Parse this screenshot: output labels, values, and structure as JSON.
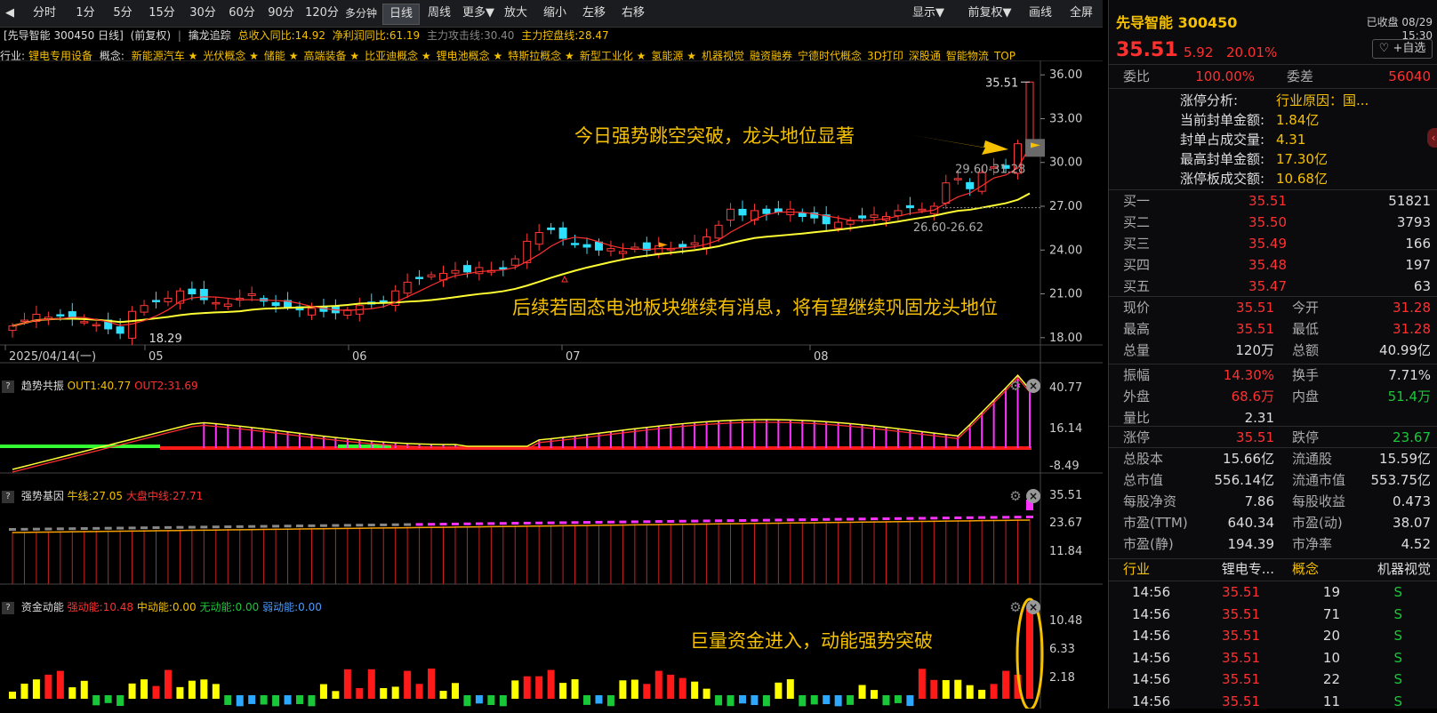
{
  "toolbar": {
    "buttons": [
      "分时",
      "1分",
      "5分",
      "15分",
      "30分",
      "60分",
      "90分",
      "120分",
      "多分钟",
      "日线",
      "周线",
      "更多▼",
      "放大",
      "缩小",
      "左移",
      "右移"
    ],
    "right_buttons": [
      "显示▼",
      "前复权▼",
      "画线",
      "全屏"
    ]
  },
  "info1": {
    "title": "[先导智能 300450 日线]",
    "adjust": "(前复权)",
    "indicator": "擒龙追踪",
    "revenue": "总收入同比:14.92",
    "profit": "净利润同比:61.19",
    "attack": "主力攻击线:30.40",
    "control": "主力控盘线:28.47"
  },
  "info2": {
    "industry_label": "行业:",
    "industry": "锂电专用设备",
    "concept_label": "概念:",
    "concepts": [
      "新能源汽车 ★",
      "光伏概念 ★",
      "储能 ★",
      "高端装备 ★",
      "比亚迪概念 ★",
      "锂电池概念 ★",
      "特斯拉概念 ★",
      "新型工业化 ★",
      "氢能源 ★",
      "机器视觉",
      "融资融券",
      "宁德时代概念",
      "3D打印",
      "深股通",
      "智能物流",
      "TOP"
    ]
  },
  "main_chart": {
    "y_ticks": [
      "36.00",
      "33.00",
      "30.00",
      "27.00",
      "24.00",
      "21.00",
      "18.00"
    ],
    "x_labels": [
      "2025/04/14(一)",
      "05",
      "06",
      "07",
      "08"
    ],
    "high_label": "35.51",
    "low_label": "18.29",
    "range_label1": "29.60-31.28",
    "range_label2": "26.60-26.62",
    "annotation1": "今日强势跳空突破，龙头地位显著",
    "annotation2": "后续若固态电池板块继续有消息，将有望继续巩固龙头地位"
  },
  "panel1": {
    "name": "趋势共振",
    "out1": "OUT1:40.77",
    "out2": "OUT2:31.69",
    "y_ticks": [
      "40.77",
      "16.14",
      "-8.49"
    ]
  },
  "panel2": {
    "name": "强势基因",
    "niu": "牛线:27.05",
    "dapan": "大盘中线:27.71",
    "y_ticks": [
      "35.51",
      "23.67",
      "11.84"
    ]
  },
  "panel3": {
    "name": "资金动能",
    "strong": "强动能:10.48",
    "mid": "中动能:0.00",
    "none": "无动能:0.00",
    "weak": "弱动能:0.00",
    "y_ticks": [
      "10.48",
      "6.33",
      "2.18"
    ],
    "annotation": "巨量资金进入，动能强势突破"
  },
  "chart_data": {
    "type": "candlestick",
    "title": "先导智能 300450 日线",
    "x_range": [
      "2025/04/14",
      "2025/08/29"
    ],
    "ylim": [
      17.5,
      36.5
    ],
    "close": [
      18.8,
      19.2,
      19.6,
      19.4,
      19.5,
      19.3,
      19.1,
      18.9,
      18.6,
      18.3,
      19.8,
      20.2,
      20.5,
      20.7,
      21.2,
      21.0,
      20.6,
      20.4,
      20.3,
      20.7,
      21.0,
      20.5,
      20.2,
      20.1,
      19.9,
      20.0,
      19.8,
      19.7,
      19.9,
      20.2,
      20.3,
      20.5,
      21.2,
      21.8,
      22.1,
      22.3,
      22.4,
      22.6,
      22.5,
      22.8,
      22.6,
      22.7,
      23.4,
      24.6,
      25.2,
      25.4,
      24.8,
      24.4,
      24.2,
      24.0,
      24.1,
      23.9,
      24.2,
      24.0,
      24.3,
      24.1,
      24.2,
      24.5,
      24.9,
      25.7,
      26.8,
      26.4,
      26.7,
      26.5,
      26.6,
      26.8,
      26.3,
      26.2,
      25.8,
      25.9,
      26.0,
      26.2,
      26.4,
      26.3,
      26.7,
      26.9,
      26.8,
      27.0,
      28.6,
      28.9,
      28.2,
      29.3,
      29.7,
      29.6,
      31.28,
      35.51
    ],
    "ma_yellow_end": 28.47,
    "ma_red_end": 30.4
  },
  "right": {
    "name": "先导智能",
    "code": "300450",
    "status": "已收盘 08/29 15:30",
    "price": "35.51",
    "change": "5.92",
    "pct": "20.01%",
    "self_select": "+自选",
    "weibi_label": "委比",
    "weibi": "100.00%",
    "weicha_label": "委差",
    "weicha": "56040",
    "zt": [
      {
        "k": "涨停分析:",
        "v": "行业原因：国..."
      },
      {
        "k": "当前封单金额:",
        "v": "1.84亿"
      },
      {
        "k": "封单占成交量:",
        "v": "4.31"
      },
      {
        "k": "最高封单金额:",
        "v": "17.30亿"
      },
      {
        "k": "涨停板成交额:",
        "v": "10.68亿"
      }
    ],
    "buys": [
      {
        "k": "买一",
        "p": "35.51",
        "v": "51821"
      },
      {
        "k": "买二",
        "p": "35.50",
        "v": "3793"
      },
      {
        "k": "买三",
        "p": "35.49",
        "v": "166"
      },
      {
        "k": "买四",
        "p": "35.48",
        "v": "197"
      },
      {
        "k": "买五",
        "p": "35.47",
        "v": "63"
      }
    ],
    "stats1": [
      {
        "k1": "现价",
        "v1": "35.51",
        "c1": "red",
        "k2": "今开",
        "v2": "31.28",
        "c2": "red"
      },
      {
        "k1": "最高",
        "v1": "35.51",
        "c1": "red",
        "k2": "最低",
        "v2": "31.28",
        "c2": "red"
      },
      {
        "k1": "总量",
        "v1": "120万",
        "c1": "white",
        "k2": "总额",
        "v2": "40.99亿",
        "c2": "white"
      }
    ],
    "stats2": [
      {
        "k1": "振幅",
        "v1": "14.30%",
        "c1": "red",
        "k2": "换手",
        "v2": "7.71%",
        "c2": "white"
      },
      {
        "k1": "外盘",
        "v1": "68.6万",
        "c1": "red",
        "k2": "内盘",
        "v2": "51.4万",
        "c2": "green"
      },
      {
        "k1": "量比",
        "v1": "2.31",
        "c1": "white",
        "k2": "",
        "v2": "",
        "c2": "white"
      }
    ],
    "stats3": [
      {
        "k1": "涨停",
        "v1": "35.51",
        "c1": "red",
        "k2": "跌停",
        "v2": "23.67",
        "c2": "green"
      }
    ],
    "stats4": [
      {
        "k1": "总股本",
        "v1": "15.66亿",
        "k2": "流通股",
        "v2": "15.59亿"
      },
      {
        "k1": "总市值",
        "v1": "556.14亿",
        "k2": "流通市值",
        "v2": "553.75亿"
      },
      {
        "k1": "每股净资",
        "v1": "7.86",
        "k2": "每股收益",
        "v2": "0.473"
      },
      {
        "k1": "市盈(TTM)",
        "v1": "640.34",
        "k2": "市盈(动)",
        "v2": "38.07"
      },
      {
        "k1": "市盈(静)",
        "v1": "194.39",
        "k2": "市净率",
        "v2": "4.52"
      }
    ],
    "industry_row": {
      "k1": "行业",
      "v1": "锂电专...",
      "k2": "概念",
      "v2": "机器视觉"
    },
    "ticks": [
      {
        "t": "14:56",
        "p": "35.51",
        "v": "19",
        "s": "S"
      },
      {
        "t": "14:56",
        "p": "35.51",
        "v": "71",
        "s": "S"
      },
      {
        "t": "14:56",
        "p": "35.51",
        "v": "20",
        "s": "S"
      },
      {
        "t": "14:56",
        "p": "35.51",
        "v": "10",
        "s": "S"
      },
      {
        "t": "14:56",
        "p": "35.51",
        "v": "22",
        "s": "S"
      },
      {
        "t": "14:56",
        "p": "35.51",
        "v": "11",
        "s": "S"
      }
    ]
  }
}
